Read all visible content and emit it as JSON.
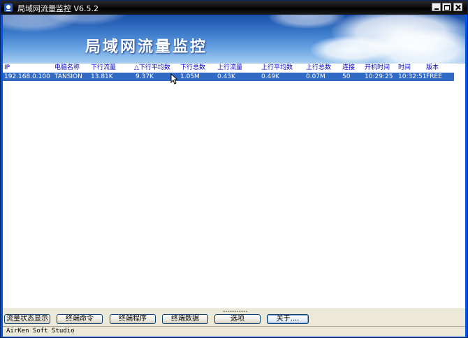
{
  "window": {
    "title": "局域网流量监控 V6.5.2",
    "banner_title": "局域网流量监控"
  },
  "table": {
    "columns": [
      "IP",
      "电脑名称",
      "下行流量",
      "△下行平均数",
      "下行总数",
      "上行流量",
      "上行平均数",
      "上行总数",
      "连接",
      "开机时间",
      "时间",
      "版本"
    ],
    "rows": [
      [
        "192.168.0.100",
        "TANSION",
        "13.81K",
        "9.37K",
        "1.05M",
        "0.43K",
        "0.49K",
        "0.07M",
        "50",
        "10:29:25",
        "10:32:51",
        "FREE"
      ]
    ]
  },
  "splitter": "-----------",
  "buttons": {
    "status_display": "流量状态显示",
    "terminal_command": "终端命令",
    "terminal_program": "终端程序",
    "terminal_data": "终端数据",
    "options": "选项",
    "about": "关于...."
  },
  "statusbar": {
    "text": "AirKen Soft Studio"
  },
  "colors": {
    "header_text": "#0000c8",
    "selection": "#316ac5",
    "titlebar": "#000000"
  },
  "icons": [
    "app-icon",
    "minimize-icon",
    "maximize-icon",
    "close-icon",
    "mouse-cursor-icon"
  ]
}
